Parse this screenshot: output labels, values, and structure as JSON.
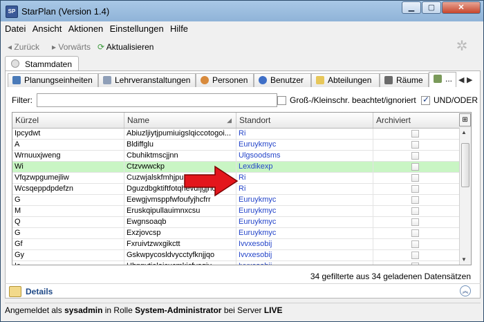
{
  "window": {
    "title": "StarPlan (Version 1.4)",
    "icon_text": "SP",
    "buttons": {
      "minimize": "▁",
      "maximize": "▢",
      "close": "✕"
    }
  },
  "menu": [
    "Datei",
    "Ansicht",
    "Aktionen",
    "Einstellungen",
    "Hilfe"
  ],
  "toolbar": {
    "back": "◂ Zurück",
    "forward": "▸ Vorwärts",
    "refresh": "Aktualisieren"
  },
  "top_tab": "Stammdaten",
  "subtabs": [
    {
      "label": "Planungseinheiten",
      "icon_color": "#4a7ab8"
    },
    {
      "label": "Lehrveranstaltungen",
      "icon_color": "#8f9fb8"
    },
    {
      "label": "Personen",
      "icon_color": "#d88a3c"
    },
    {
      "label": "Benutzer",
      "icon_color": "#3f6fc7"
    },
    {
      "label": "Abteilungen",
      "icon_color": "#e7c75a"
    },
    {
      "label": "Räume",
      "icon_color": "#6b6b6b"
    },
    {
      "label": "...",
      "icon_color": "#7a9a5a"
    }
  ],
  "filter": {
    "label": "Filter:",
    "value": "",
    "case_label": "Groß-/Kleinschr. beachtet/ignoriert",
    "case_checked": false,
    "logic_label": "UND/ODER",
    "logic_checked": true
  },
  "table": {
    "columns": [
      "Kürzel",
      "Name",
      "Standort",
      "Archiviert"
    ],
    "sorted_column": 1,
    "sort_glyph": "◢",
    "column_picker": "⊞",
    "rows": [
      {
        "kuerzel": "Ipcydwt",
        "name": "Abiuzljiytjpumiuigslqiccotogoi...",
        "standort": "Ri",
        "archiviert": false
      },
      {
        "kuerzel": "A",
        "name": "Bldiffglu",
        "standort": "Euruykmyc",
        "archiviert": false
      },
      {
        "kuerzel": "Wrnuuxjweng",
        "name": "Cbuhiktmscjjnn",
        "standort": "Ulgsoodsms",
        "archiviert": false
      },
      {
        "kuerzel": "Wi",
        "name": "Ctzvwwckp",
        "standort": "Lexdikexp",
        "archiviert": false,
        "highlight": true
      },
      {
        "kuerzel": "Vfqzwpgumejliw",
        "name": "Cuzwjalskfmhjpu",
        "standort": "Ri",
        "archiviert": false
      },
      {
        "kuerzel": "Wcsqeppdpdefzn",
        "name": "Dguzdbgktiftfotqhevdfjgjrlo",
        "standort": "Ri",
        "archiviert": false
      },
      {
        "kuerzel": "G",
        "name": "Eewgjvmsppfwfoufyjhcfrr",
        "standort": "Euruykmyc",
        "archiviert": false
      },
      {
        "kuerzel": "M",
        "name": "Eruskqipullauimnxcsu",
        "standort": "Euruykmyc",
        "archiviert": false
      },
      {
        "kuerzel": "Q",
        "name": "Ewgnsoaqb",
        "standort": "Euruykmyc",
        "archiviert": false
      },
      {
        "kuerzel": "G",
        "name": "Exzjovcsp",
        "standort": "Euruykmyc",
        "archiviert": false
      },
      {
        "kuerzel": "Gf",
        "name": "Fxruivtzwxgikctt",
        "standort": "Ivvxesobij",
        "archiviert": false
      },
      {
        "kuerzel": "Gy",
        "name": "Gskwpycosldvycctyfknjjqo",
        "standort": "Ivvxesobij",
        "archiviert": false
      },
      {
        "kuerzel": "Ic",
        "name": "Hbnnvtielaicucmkicfyogiy",
        "standort": "Ivvxesobij",
        "archiviert": false
      }
    ]
  },
  "record_count": "34 gefilterte aus 34 geladenen Datensätzen",
  "details": {
    "label": "Details",
    "expand_glyph": "︽"
  },
  "status": {
    "prefix": "Angemeldet als ",
    "user": "sysadmin",
    "mid": " in Rolle ",
    "role": "System-Administrator",
    "mid2": " bei Server ",
    "server": "LIVE"
  }
}
